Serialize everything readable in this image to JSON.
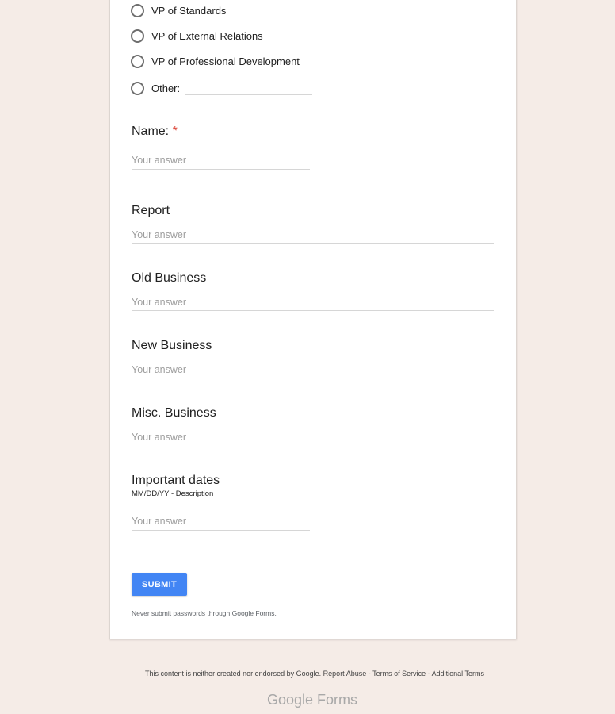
{
  "radio_options": [
    {
      "label": "VP of Standards"
    },
    {
      "label": "VP of External Relations"
    },
    {
      "label": "VP of Professional Development"
    },
    {
      "label": "Other:"
    }
  ],
  "questions": {
    "name": {
      "title": "Name:",
      "required_mark": "*",
      "placeholder": "Your answer"
    },
    "report": {
      "title": "Report",
      "placeholder": "Your answer"
    },
    "old_business": {
      "title": "Old Business",
      "placeholder": "Your answer"
    },
    "new_business": {
      "title": "New Business",
      "placeholder": "Your answer"
    },
    "misc_business": {
      "title": "Misc. Business",
      "placeholder": "Your answer"
    },
    "important_dates": {
      "title": "Important dates",
      "description": "MM/DD/YY - Description",
      "placeholder": "Your answer"
    }
  },
  "submit_label": "SUBMIT",
  "password_warning": "Never submit passwords through Google Forms.",
  "footer": {
    "disclaimer": "This content is neither created nor endorsed by Google.",
    "report_abuse": "Report Abuse",
    "terms_of_service": "Terms of Service",
    "additional_terms": "Additional Terms",
    "separator": " - "
  },
  "logo": {
    "google": "Google",
    "forms": "Forms"
  },
  "colors": {
    "accent": "#4285f4",
    "required": "#db4437",
    "background": "#f5ece7"
  }
}
